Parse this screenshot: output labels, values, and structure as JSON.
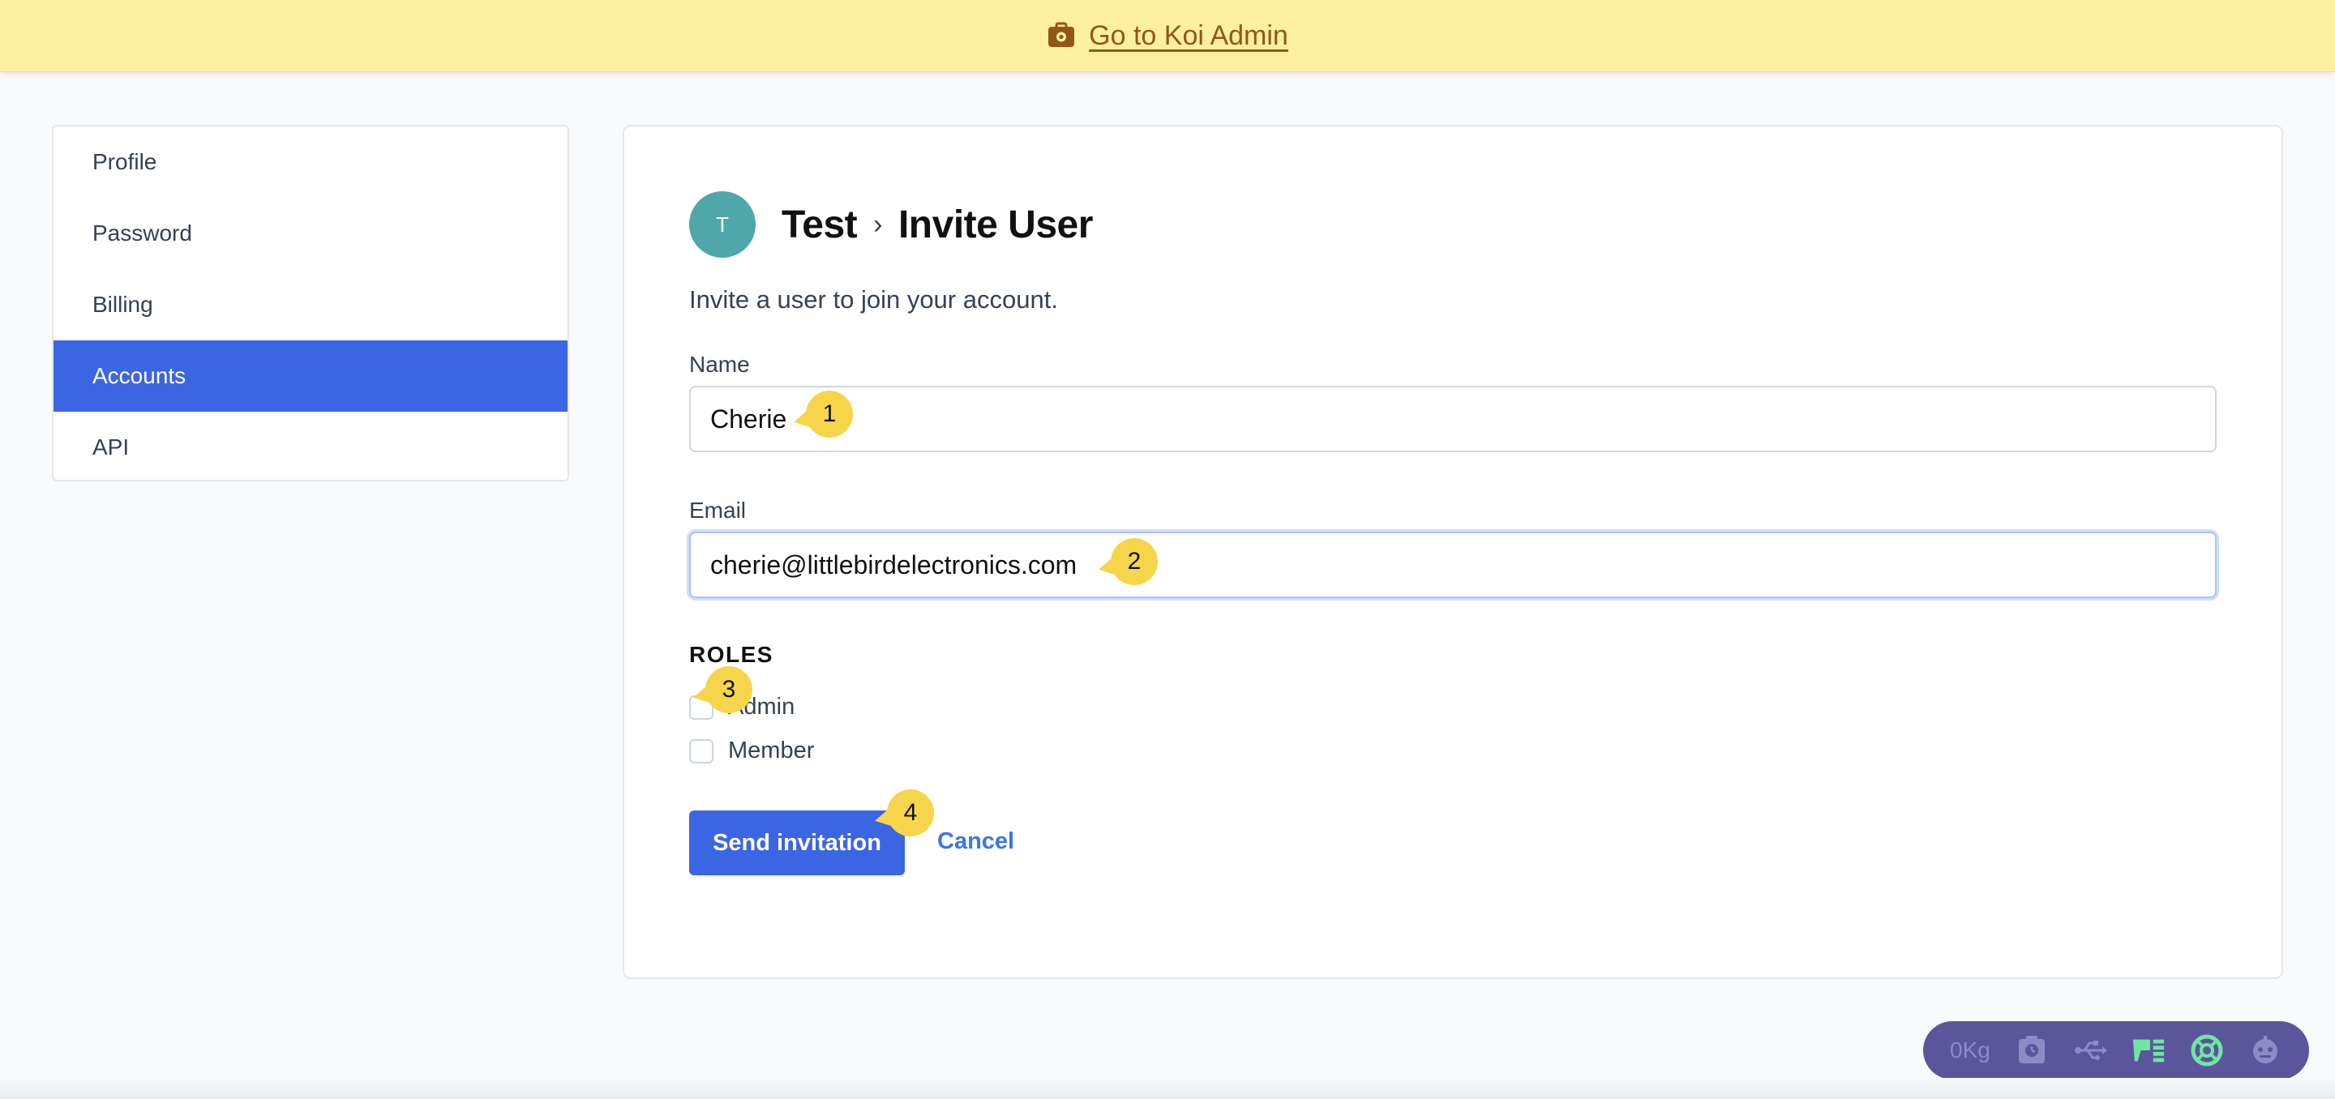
{
  "banner": {
    "link_label": "Go to Koi Admin",
    "icon": "admin-gear-case-icon"
  },
  "sidebar": {
    "items": [
      {
        "label": "Profile",
        "active": false
      },
      {
        "label": "Password",
        "active": false
      },
      {
        "label": "Billing",
        "active": false
      },
      {
        "label": "Accounts",
        "active": true
      },
      {
        "label": "API",
        "active": false
      }
    ]
  },
  "main": {
    "avatar_initial": "T",
    "breadcrumb_account": "Test",
    "breadcrumb_separator": "›",
    "page_title": "Invite User",
    "description": "Invite a user to join your account.",
    "name_label": "Name",
    "name_value": "Cherie",
    "email_label": "Email",
    "email_value": "cherie@littlebirdelectronics.com",
    "roles_title": "ROLES",
    "roles": [
      {
        "label": "Admin",
        "checked": false
      },
      {
        "label": "Member",
        "checked": false
      }
    ],
    "submit_label": "Send invitation",
    "cancel_label": "Cancel"
  },
  "markers": [
    "1",
    "2",
    "3",
    "4"
  ],
  "toolbar": {
    "weight_label": "0Kg",
    "icons": [
      "clipboard-clock-icon",
      "usb-icon",
      "signal-bars-icon",
      "lifebuoy-icon",
      "robot-icon"
    ]
  },
  "colors": {
    "banner_bg": "#fdf0a0",
    "banner_link": "#92561a",
    "accent": "#3b66e3",
    "avatar": "#4fa7a9",
    "marker": "#f7d54a",
    "toolbar_bg": "#5b569c"
  }
}
